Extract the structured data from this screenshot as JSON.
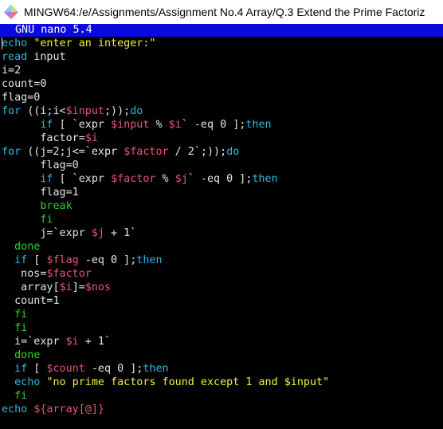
{
  "window": {
    "title": "MINGW64:/e/Assignments/Assignment No.4 Array/Q.3 Extend the Prime Factoriz",
    "icon": "mingw-diamond-icon"
  },
  "editor_header": {
    "title": "GNU nano 5.4"
  },
  "colors": {
    "keyword": "#2fb8e0",
    "string": "#f2f23a",
    "variable": "#e8557a",
    "control": "#2bd12b",
    "text": "#e6e6e6",
    "header_bg": "#0a0adf"
  },
  "code_lines": [
    [
      [
        "kw",
        "echo"
      ],
      [
        "txt",
        " "
      ],
      [
        "str",
        "\"enter an integer:\""
      ]
    ],
    [
      [
        "kw",
        "read"
      ],
      [
        "txt",
        " input"
      ]
    ],
    [
      [
        "txt",
        "i=2"
      ]
    ],
    [
      [
        "txt",
        "count=0"
      ]
    ],
    [
      [
        "txt",
        "flag=0"
      ]
    ],
    [
      [
        "kw",
        "for"
      ],
      [
        "txt",
        " ((i;i<"
      ],
      [
        "var",
        "$input"
      ],
      [
        "txt",
        ";));"
      ],
      [
        "kw",
        "do"
      ]
    ],
    [
      [
        "txt",
        "      "
      ],
      [
        "kw",
        "if"
      ],
      [
        "txt",
        " [ `expr "
      ],
      [
        "var",
        "$input"
      ],
      [
        "txt",
        " % "
      ],
      [
        "var",
        "$i"
      ],
      [
        "txt",
        "` -eq 0 ];"
      ],
      [
        "kw",
        "then"
      ]
    ],
    [
      [
        "txt",
        "      factor="
      ],
      [
        "var",
        "$i"
      ]
    ],
    [
      [
        "kw",
        "for"
      ],
      [
        "txt",
        " ((j=2;j<=`expr "
      ],
      [
        "var",
        "$factor"
      ],
      [
        "txt",
        " / 2`;));"
      ],
      [
        "kw",
        "do"
      ]
    ],
    [
      [
        "txt",
        "      flag=0"
      ]
    ],
    [
      [
        "txt",
        "      "
      ],
      [
        "kw",
        "if"
      ],
      [
        "txt",
        " [ `expr "
      ],
      [
        "var",
        "$factor"
      ],
      [
        "txt",
        " % "
      ],
      [
        "var",
        "$j"
      ],
      [
        "txt",
        "` -eq 0 ];"
      ],
      [
        "kw",
        "then"
      ]
    ],
    [
      [
        "txt",
        "      flag=1"
      ]
    ],
    [
      [
        "txt",
        "      "
      ],
      [
        "ctl",
        "break"
      ]
    ],
    [
      [
        "txt",
        "      "
      ],
      [
        "ctl",
        "fi"
      ]
    ],
    [
      [
        "txt",
        "      j=`expr "
      ],
      [
        "var",
        "$j"
      ],
      [
        "txt",
        " + 1`"
      ]
    ],
    [
      [
        "txt",
        "  "
      ],
      [
        "ctl",
        "done"
      ]
    ],
    [
      [
        "txt",
        "  "
      ],
      [
        "kw",
        "if"
      ],
      [
        "txt",
        " [ "
      ],
      [
        "var",
        "$flag"
      ],
      [
        "txt",
        " -eq 0 ];"
      ],
      [
        "kw",
        "then"
      ]
    ],
    [
      [
        "txt",
        "   nos="
      ],
      [
        "var",
        "$factor"
      ]
    ],
    [
      [
        "txt",
        "   array["
      ],
      [
        "var",
        "$i"
      ],
      [
        "txt",
        "]="
      ],
      [
        "var",
        "$nos"
      ]
    ],
    [
      [
        "txt",
        "  count=1"
      ]
    ],
    [
      [
        "txt",
        "  "
      ],
      [
        "ctl",
        "fi"
      ]
    ],
    [
      [
        "txt",
        "  "
      ],
      [
        "ctl",
        "fi"
      ]
    ],
    [
      [
        "txt",
        "  i=`expr "
      ],
      [
        "var",
        "$i"
      ],
      [
        "txt",
        " + 1`"
      ]
    ],
    [
      [
        "txt",
        "  "
      ],
      [
        "ctl",
        "done"
      ]
    ],
    [
      [
        "txt",
        "  "
      ],
      [
        "kw",
        "if"
      ],
      [
        "txt",
        " [ "
      ],
      [
        "var",
        "$count"
      ],
      [
        "txt",
        " -eq 0 ];"
      ],
      [
        "kw",
        "then"
      ]
    ],
    [
      [
        "txt",
        "  "
      ],
      [
        "kw",
        "echo"
      ],
      [
        "txt",
        " "
      ],
      [
        "str",
        "\"no prime factors found except 1 and $input\""
      ]
    ],
    [
      [
        "txt",
        "  "
      ],
      [
        "ctl",
        "fi"
      ]
    ],
    [
      [
        "kw",
        "echo"
      ],
      [
        "txt",
        " "
      ],
      [
        "var",
        "${array[@]}"
      ]
    ]
  ]
}
